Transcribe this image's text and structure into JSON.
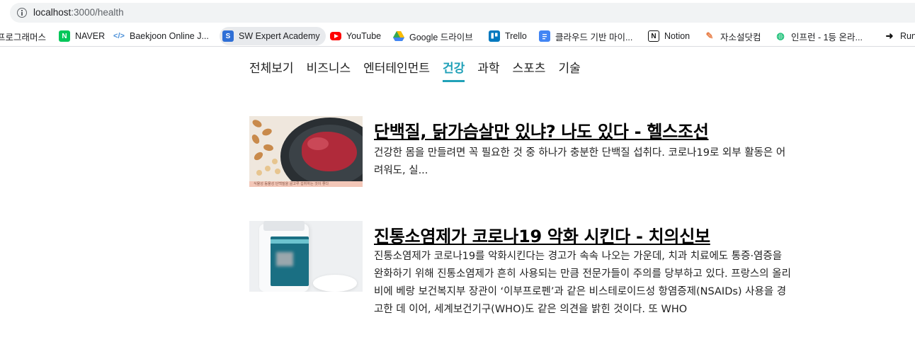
{
  "browser": {
    "url_host": "localhost",
    "url_path": ":3000/health",
    "bookmarks": [
      {
        "label": "프로그래머스",
        "icon": "none"
      },
      {
        "label": "NAVER",
        "icon": "naver-icon"
      },
      {
        "label": "Baekjoon Online J...",
        "icon": "code-icon"
      },
      {
        "label": "SW Expert Academy",
        "icon": "swea-icon"
      },
      {
        "label": "YouTube",
        "icon": "youtube-icon"
      },
      {
        "label": "Google 드라이브",
        "icon": "google-drive-icon"
      },
      {
        "label": "Trello",
        "icon": "trello-icon"
      },
      {
        "label": "클라우드 기반 마이...",
        "icon": "docs-icon"
      },
      {
        "label": "Notion",
        "icon": "notion-icon"
      },
      {
        "label": "자소설닷컴",
        "icon": "pencil-icon"
      },
      {
        "label": "인프런 - 1등 온라...",
        "icon": "inflearn-icon"
      },
      {
        "label": "Run",
        "icon": "arrow-icon"
      }
    ]
  },
  "nav": {
    "accent": "#21a1b8",
    "items": [
      {
        "label": "전체보기"
      },
      {
        "label": "비즈니스"
      },
      {
        "label": "엔터테인먼트"
      },
      {
        "label": "건강",
        "active": true
      },
      {
        "label": "과학"
      },
      {
        "label": "스포츠"
      },
      {
        "label": "기술"
      }
    ]
  },
  "articles": [
    {
      "title": "단백질, 닭가슴살만 있냐? 나도 있다 - 헬스조선",
      "description": "건강한 몸을 만들려면 꼭 필요한 것 중 하나가 충분한 단백질 섭취다. 코로나19로 외부 활동은 어려워도, 실...",
      "thumb_caption": "식물성 동물성 단백질을 골고루 섭취하는 것이 좋다"
    },
    {
      "title": "진통소염제가 코로나19 악화 시킨다 - 치의신보",
      "description": "진통소염제가 코로나19를 악화시킨다는 경고가 속속 나오는 가운데, 치과 치료에도 통증·염증을 완화하기 위해 진통소염제가 흔히 사용되는 만큼 전문가들이 주의를 당부하고 있다. 프랑스의 올리비에 베랑 보건복지부 장관이 ‘이부프로펜’과 같은 비스테로이드성 항염증제(NSAIDs) 사용을 경고한 데 이어, 세계보건기구(WHO)도 같은 의견을 밝힌 것이다. 또 WHO"
    }
  ]
}
